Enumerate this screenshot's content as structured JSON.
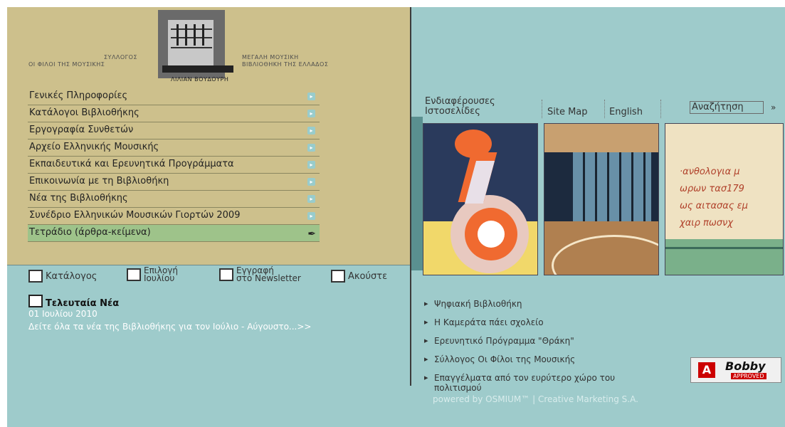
{
  "logo": {
    "left_line1": "ΣΥΛΛΟΓΟΣ",
    "left_line2": "ΟΙ ΦΙΛΟΙ ΤΗΣ ΜΟΥΣΙΚΗΣ",
    "right_line1": "ΜΕΓΑΛΗ ΜΟΥΣΙΚΗ",
    "right_line2": "ΒΙΒΛΙΟΘΗΚΗ ΤΗΣ ΕΛΛΑΔΟΣ",
    "bottom": "ΛΙΛΙΑΝ ΒΟΥΔΟΥΡΗ"
  },
  "menu": [
    {
      "label": "Γενικές Πληροφορίες"
    },
    {
      "label": "Κατάλογοι Βιβλιοθήκης"
    },
    {
      "label": "Εργογραφία Συνθετών"
    },
    {
      "label": "Αρχείο Ελληνικής Μουσικής"
    },
    {
      "label": "Εκπαιδευτικά και Ερευνητικά Προγράμματα"
    },
    {
      "label": "Επικοινωνία με τη Βιβλιοθήκη"
    },
    {
      "label": "Νέα της Βιβλιοθήκης"
    },
    {
      "label": "Συνέδριο Ελληνικών Μουσικών Γιορτών 2009"
    },
    {
      "label": "Τετράδιο (άρθρα-κείμενα)"
    }
  ],
  "toolbar": {
    "catalog": "Κατάλογος",
    "pick_line1": "Επιλογή",
    "pick_line2": "Ιουλίου",
    "signup_line1": "Εγγραφή",
    "signup_line2": "στο Newsletter",
    "listen": "Ακούστε"
  },
  "news": {
    "title": "Τελευταία Νέα",
    "date": "01 Ιουλίου 2010",
    "link": "Δείτε όλα τα νέα της Βιβλιοθήκης για τον Ιούλιο - Αύγουστο...>>"
  },
  "topnav": {
    "interesting_line1": "Ενδιαφέρουσες",
    "interesting_line2": "Ιστοσελίδες",
    "sitemap": "Site Map",
    "english": "English",
    "search": "Αναζήτηση",
    "go": "»"
  },
  "links": [
    "Ψηφιακή Βιβλιοθήκη",
    "Η Καμεράτα πάει σχολείο",
    "Ερευνητικό Πρόγραμμα \"Θράκη\"",
    "Σύλλογος Οι Φίλοι της Μουσικής",
    "Επαγγέλματα από τον ευρύτερο χώρο του πολιτισμού"
  ],
  "bobby": {
    "letter": "A",
    "name": "Bobby",
    "status": "APPROVED"
  },
  "footer": "powered by OSMIUM™ | Creative Marketing S.A.",
  "colors": {
    "left_panel": "#cdc08c",
    "page_bg": "#9ecbcb",
    "active_menu": "#9ec38a"
  }
}
